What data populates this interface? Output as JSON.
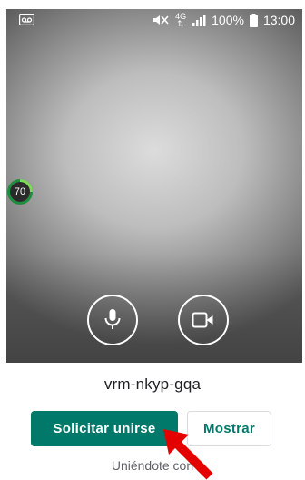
{
  "status_bar": {
    "network": "4G",
    "battery": "100%",
    "time": "13:00",
    "icons": [
      "voicemail-icon",
      "mute-icon",
      "network-4g-icon",
      "signal-icon",
      "battery-icon"
    ]
  },
  "preview": {
    "badge_value": "70",
    "controls": [
      "microphone-icon",
      "camera-icon"
    ]
  },
  "meeting": {
    "code": "vrm-nkyp-gqa",
    "join_button": "Solicitar unirse",
    "present_button": "Mostrar",
    "joining_text": "Uniéndote con"
  },
  "colors": {
    "accent": "#00796b",
    "annotation_arrow": "#e50000"
  }
}
